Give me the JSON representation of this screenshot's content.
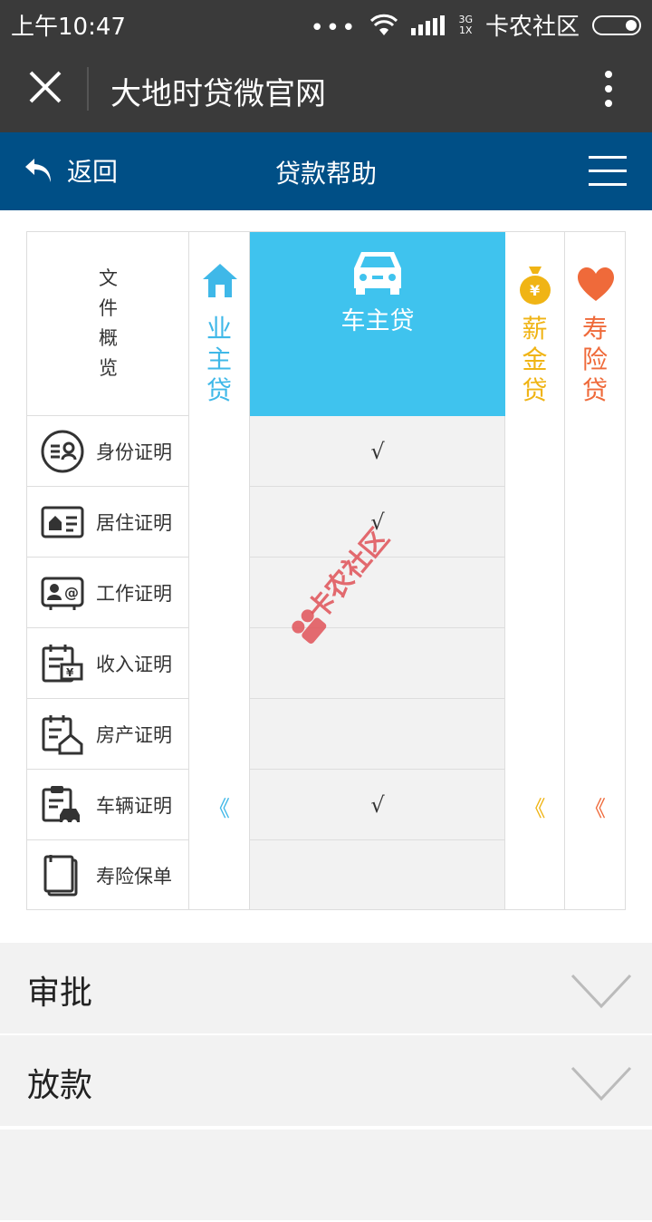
{
  "status_bar": {
    "time": "上午10:47",
    "dots": "•••",
    "network_top": "3G",
    "network_bottom": "1X",
    "carrier": "卡农社区"
  },
  "wechat_bar": {
    "title": "大地时贷微官网"
  },
  "nav": {
    "back_label": "返回",
    "title": "贷款帮助"
  },
  "grid": {
    "doc_header": [
      "文",
      "件",
      "概",
      "览"
    ],
    "documents": [
      {
        "label": "身份证明",
        "icon": "id-card-icon"
      },
      {
        "label": "居住证明",
        "icon": "residence-card-icon"
      },
      {
        "label": "工作证明",
        "icon": "work-card-icon"
      },
      {
        "label": "收入证明",
        "icon": "income-doc-icon"
      },
      {
        "label": "房产证明",
        "icon": "property-doc-icon"
      },
      {
        "label": "车辆证明",
        "icon": "vehicle-doc-icon"
      },
      {
        "label": "寿险保单",
        "icon": "policy-doc-icon"
      }
    ],
    "products": {
      "owner": {
        "chars": [
          "业",
          "主",
          "贷"
        ],
        "color": "#3fb8e8",
        "arrow": "《",
        "icon": "house-icon"
      },
      "car": {
        "label": "车主贷",
        "color": "#3fc3ee",
        "icon": "car-icon",
        "checks": [
          "√",
          "√",
          "",
          "",
          "",
          "√",
          ""
        ]
      },
      "salary": {
        "chars": [
          "薪",
          "金",
          "贷"
        ],
        "color": "#f0b415",
        "arrow": "《",
        "icon": "money-bag-icon"
      },
      "life": {
        "chars": [
          "寿",
          "险",
          "贷"
        ],
        "color": "#ef6a3a",
        "arrow": "《",
        "icon": "heart-icon"
      }
    }
  },
  "watermark": {
    "text": "卡农社区"
  },
  "accordion": [
    {
      "title": "审批"
    },
    {
      "title": "放款"
    }
  ]
}
